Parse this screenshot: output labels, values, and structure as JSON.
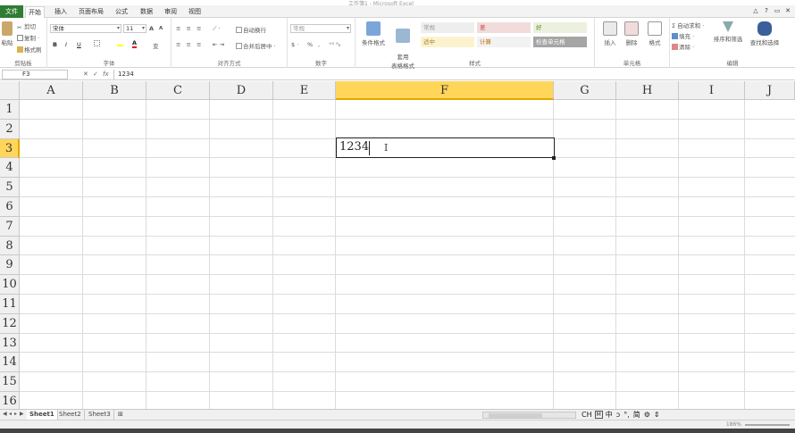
{
  "window": {
    "title": "工作簿1 - Microsoft Excel"
  },
  "tabs": [
    {
      "label": "文件",
      "kind": "file"
    },
    {
      "label": "开始",
      "kind": "active"
    },
    {
      "label": "插入"
    },
    {
      "label": "页面布局"
    },
    {
      "label": "公式"
    },
    {
      "label": "数据"
    },
    {
      "label": "审阅"
    },
    {
      "label": "视图"
    }
  ],
  "ribbon": {
    "clipboard": {
      "label": "剪贴板",
      "paste": "粘贴",
      "cut": "剪切",
      "copy": "复制 ·",
      "format_painter": "格式刷"
    },
    "font": {
      "label": "字体",
      "font_name": "宋体",
      "font_size": "11",
      "bold": "B",
      "italic": "I",
      "underline": "U",
      "grow": "A",
      "shrink": "A",
      "font_color": "A",
      "wen": "变"
    },
    "alignment": {
      "label": "对齐方式",
      "wrap": "自动换行",
      "merge": "合并后居中 ·"
    },
    "number": {
      "label": "数字",
      "format": "常规",
      "percent": "%",
      "comma": ","
    },
    "styles": {
      "label": "样式",
      "conditional": "条件格式",
      "table": "套用\n表格格式",
      "cells": [
        {
          "text": "常规",
          "bg": "#eeeeee",
          "color": "#999999"
        },
        {
          "text": "差",
          "bg": "#f2dcdb",
          "color": "#c0504d"
        },
        {
          "text": "好",
          "bg": "#ebf1de",
          "color": "#6b8e23"
        },
        {
          "text": "适中",
          "bg": "#fdf2d0",
          "color": "#a08020"
        },
        {
          "text": "计算",
          "bg": "#f2f2f2",
          "color": "#c07000"
        },
        {
          "text": "检查单元格",
          "bg": "#a5a5a5",
          "color": "#ffffff"
        }
      ]
    },
    "cells": {
      "label": "单元格",
      "insert": "插入",
      "delete": "删除",
      "format": "格式"
    },
    "editing": {
      "label": "编辑",
      "autosum": "Σ 自动求和 ·",
      "fill": "填充 ·",
      "clear": "清除 ·",
      "sort": "排序和筛选",
      "find": "查找和选择"
    }
  },
  "formula_bar": {
    "name_box": "F3",
    "cancel": "✕",
    "enter": "✓",
    "fx": "fx",
    "content": "1234"
  },
  "columns": [
    "A",
    "B",
    "C",
    "D",
    "E",
    "F",
    "G",
    "H",
    "I",
    "J"
  ],
  "selected_column": "F",
  "rows": [
    "1",
    "2",
    "3",
    "4",
    "5",
    "6",
    "7",
    "8",
    "9",
    "10",
    "11",
    "12",
    "13",
    "14",
    "15",
    "16"
  ],
  "selected_row": "3",
  "active_cell": {
    "ref": "F3",
    "value": "1234"
  },
  "sheets": [
    "Sheet1",
    "Sheet2",
    "Sheet3"
  ],
  "active_sheet": "Sheet1",
  "ime": [
    "CH",
    "M",
    "中",
    "ɔ",
    "°,",
    "简",
    "⚙",
    "⇕"
  ],
  "status": {
    "zoom": "186%"
  },
  "colors": {
    "accent": "#2f7d32",
    "selected_header": "#ffd65a"
  }
}
